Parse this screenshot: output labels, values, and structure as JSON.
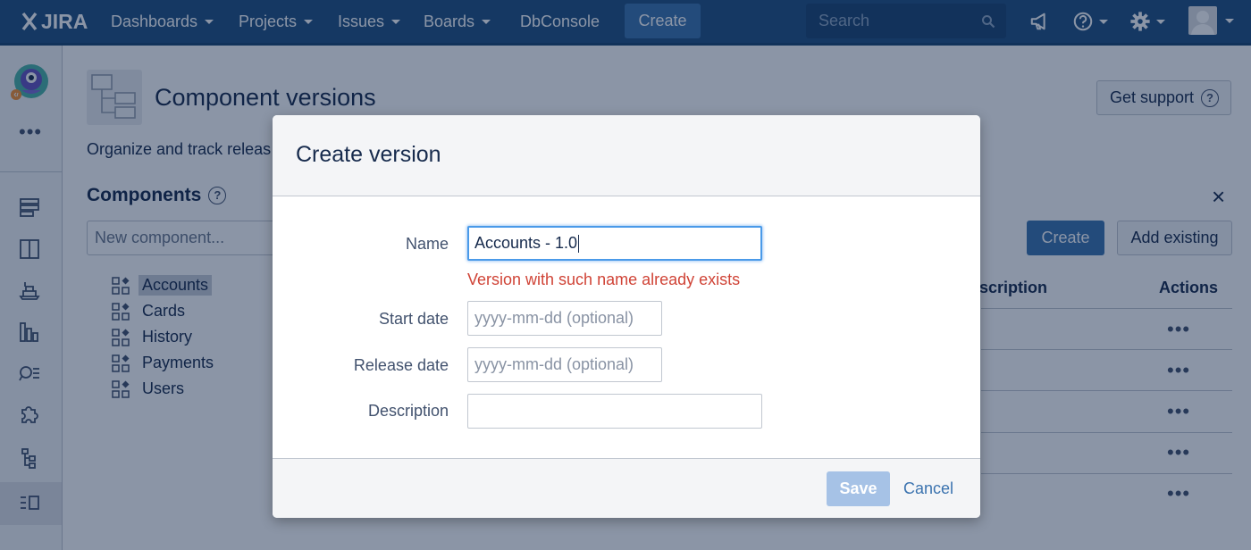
{
  "topnav": {
    "logo_text": "JIRA",
    "items": [
      "Dashboards",
      "Projects",
      "Issues",
      "Boards",
      "DbConsole"
    ],
    "create_label": "Create",
    "search_placeholder": "Search",
    "icons": [
      "megaphone-icon",
      "help-icon",
      "gear-icon",
      "avatar"
    ]
  },
  "sidebar": {
    "more_label": "•••",
    "icons": [
      "backlog-icon",
      "board-icon",
      "releases-icon",
      "reports-icon",
      "issues-search-icon",
      "add-ons-icon",
      "components-icon",
      "component-versions-icon"
    ]
  },
  "page": {
    "title": "Component versions",
    "description": "Organize and track releas",
    "get_support_label": "Get support",
    "help_glyph": "?",
    "close_glyph": "×",
    "components_heading": "Components",
    "new_component_placeholder": "New component...",
    "create_label": "Create",
    "add_existing_label": "Add existing",
    "components": [
      "Accounts",
      "Cards",
      "History",
      "Payments",
      "Users"
    ],
    "table": {
      "description_header": "scription",
      "actions_header": "Actions",
      "row_action": "•••"
    }
  },
  "dialog": {
    "title": "Create version",
    "fields": {
      "name_label": "Name",
      "name_value": "Accounts - 1.0",
      "name_error": "Version with such name already exists",
      "start_label": "Start date",
      "start_placeholder": "yyyy-mm-dd (optional)",
      "release_label": "Release date",
      "release_placeholder": "yyyy-mm-dd (optional)",
      "description_label": "Description",
      "description_value": ""
    },
    "save_label": "Save",
    "cancel_label": "Cancel"
  },
  "colors": {
    "nav": "#205081",
    "primary_button": "#3b73af",
    "error": "#d04437",
    "focus": "#4a9ae9",
    "disabled_button": "#a6c2e6"
  }
}
